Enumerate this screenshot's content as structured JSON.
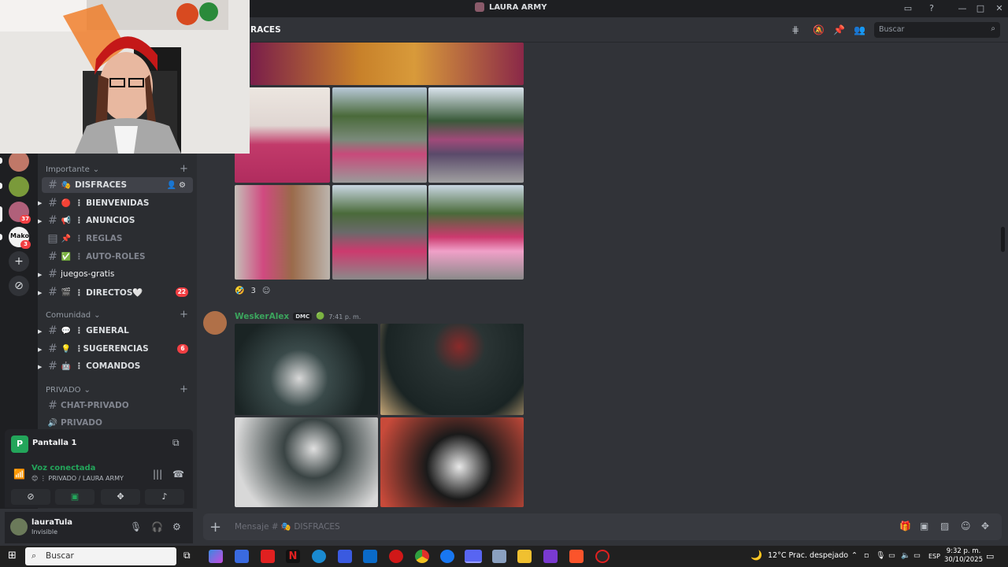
{
  "window": {
    "title": "LAURA ARMY"
  },
  "header": {
    "channel_name": "RACES",
    "search_placeholder": "Buscar"
  },
  "servers": [
    {
      "badge": ""
    },
    {
      "badge": ""
    },
    {
      "badge": "37"
    },
    {
      "badge": "3"
    }
  ],
  "categories": {
    "importante": "Importante",
    "comunidad": "Comunidad",
    "privado": "PRIVADO"
  },
  "channels": [
    {
      "emoji": "🎭",
      "name": "DISFRACES"
    },
    {
      "emoji": "🔴",
      "name": "⋮ BIENVENIDAS"
    },
    {
      "emoji": "📢",
      "name": "⋮ ANUNCIOS"
    },
    {
      "emoji": "📌",
      "name": "⋮ REGLAS"
    },
    {
      "emoji": "✅",
      "name": "⋮ AUTO-ROLES"
    },
    {
      "emoji": "",
      "name": "juegos-gratis"
    },
    {
      "emoji": "🎬",
      "name": "⋮ DIRECTOS🤍",
      "badge": "22"
    },
    {
      "emoji": "💬",
      "name": "⋮ GENERAL"
    },
    {
      "emoji": "💡",
      "name": "⋮SUGERENCIAS",
      "badge": "6"
    },
    {
      "emoji": "🤖",
      "name": "⋮ COMANDOS"
    },
    {
      "emoji": "",
      "name": "CHAT-PRIVADO"
    },
    {
      "emoji": "",
      "name": "PRIVADO"
    }
  ],
  "screen_share": {
    "label": "Pantalla 1"
  },
  "voice": {
    "status": "Voz conectada",
    "location": "😊 ⋮ PRIVADO / LAURA ARMY"
  },
  "user": {
    "name": "lauraTula",
    "status": "Invisible"
  },
  "messages": {
    "reaction_count": "3",
    "author": "WeskerAlex",
    "author_tag": "DMC",
    "time": "7:41 p. m."
  },
  "composer": {
    "placeholder": "Mensaje # 🎭 DISFRACES"
  },
  "taskbar": {
    "search": "Buscar",
    "weather": "12°C  Prac. despejado",
    "lang": "ESP",
    "time": "9:32 p. m.",
    "date": "30/10/2025"
  },
  "colors": {
    "accent_green": "#23a55a",
    "badge_red": "#f23f43",
    "author_green": "#3ba55d"
  }
}
